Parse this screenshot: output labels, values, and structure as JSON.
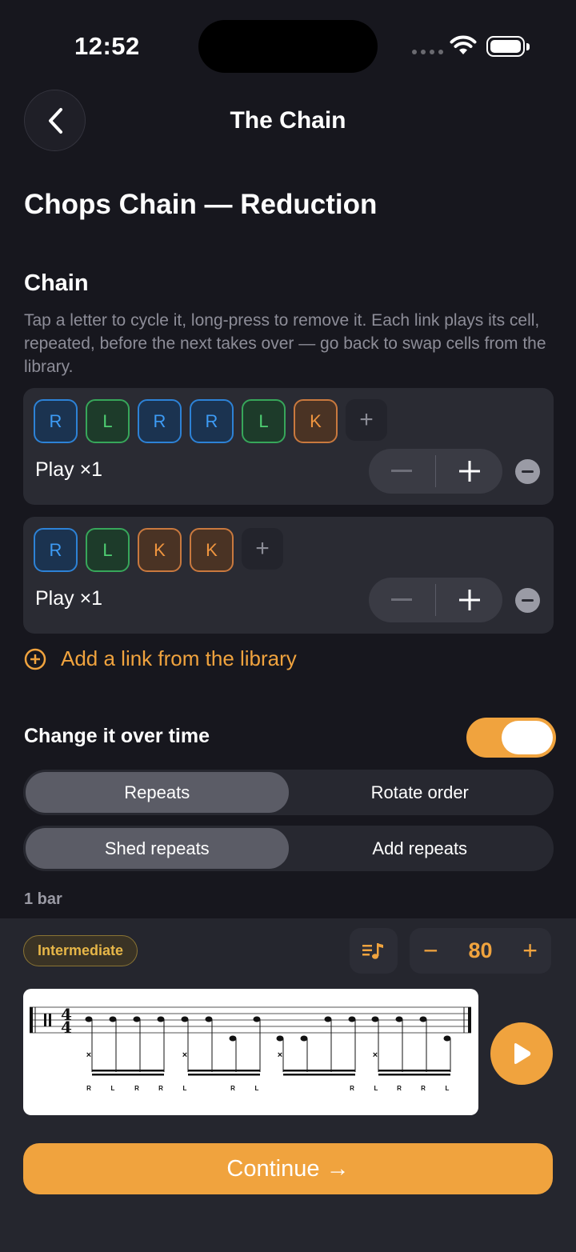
{
  "status": {
    "time": "12:52"
  },
  "nav": {
    "title": "The Chain"
  },
  "page": {
    "title": "Chops Chain — Reduction",
    "chain_heading": "Chain",
    "chain_description": "Tap a letter to cycle it, long-press to remove it. Each link plays its cell, repeated, before the next takes over — go back to swap cells from the library."
  },
  "links": [
    {
      "letters": [
        "R",
        "L",
        "R",
        "R",
        "L",
        "K"
      ],
      "play_label": "Play ×1"
    },
    {
      "letters": [
        "R",
        "L",
        "K",
        "K"
      ],
      "play_label": "Play ×1"
    }
  ],
  "add_letter_symbol": "+",
  "add_link_label": "Add a link from the library",
  "change_over_time": {
    "label": "Change it over time",
    "enabled": true,
    "mode_options": [
      "Repeats",
      "Rotate order"
    ],
    "mode_selected": "Repeats",
    "direction_options": [
      "Shed repeats",
      "Add repeats"
    ],
    "direction_selected": "Shed repeats",
    "length": "1 bar"
  },
  "player": {
    "level": "Intermediate",
    "tempo": "80",
    "tempo_minus": "−",
    "tempo_plus": "+",
    "sticking": [
      "R",
      "L",
      "R",
      "R",
      "L",
      "R",
      "L",
      "R",
      "L",
      "R",
      "R",
      "L"
    ],
    "time_signature": "4/4"
  },
  "continue_label": "Continue →",
  "colors": {
    "accent": "#f0a33e",
    "right": "#3d9bf5",
    "left": "#4fcf72",
    "kick": "#f0953f"
  }
}
